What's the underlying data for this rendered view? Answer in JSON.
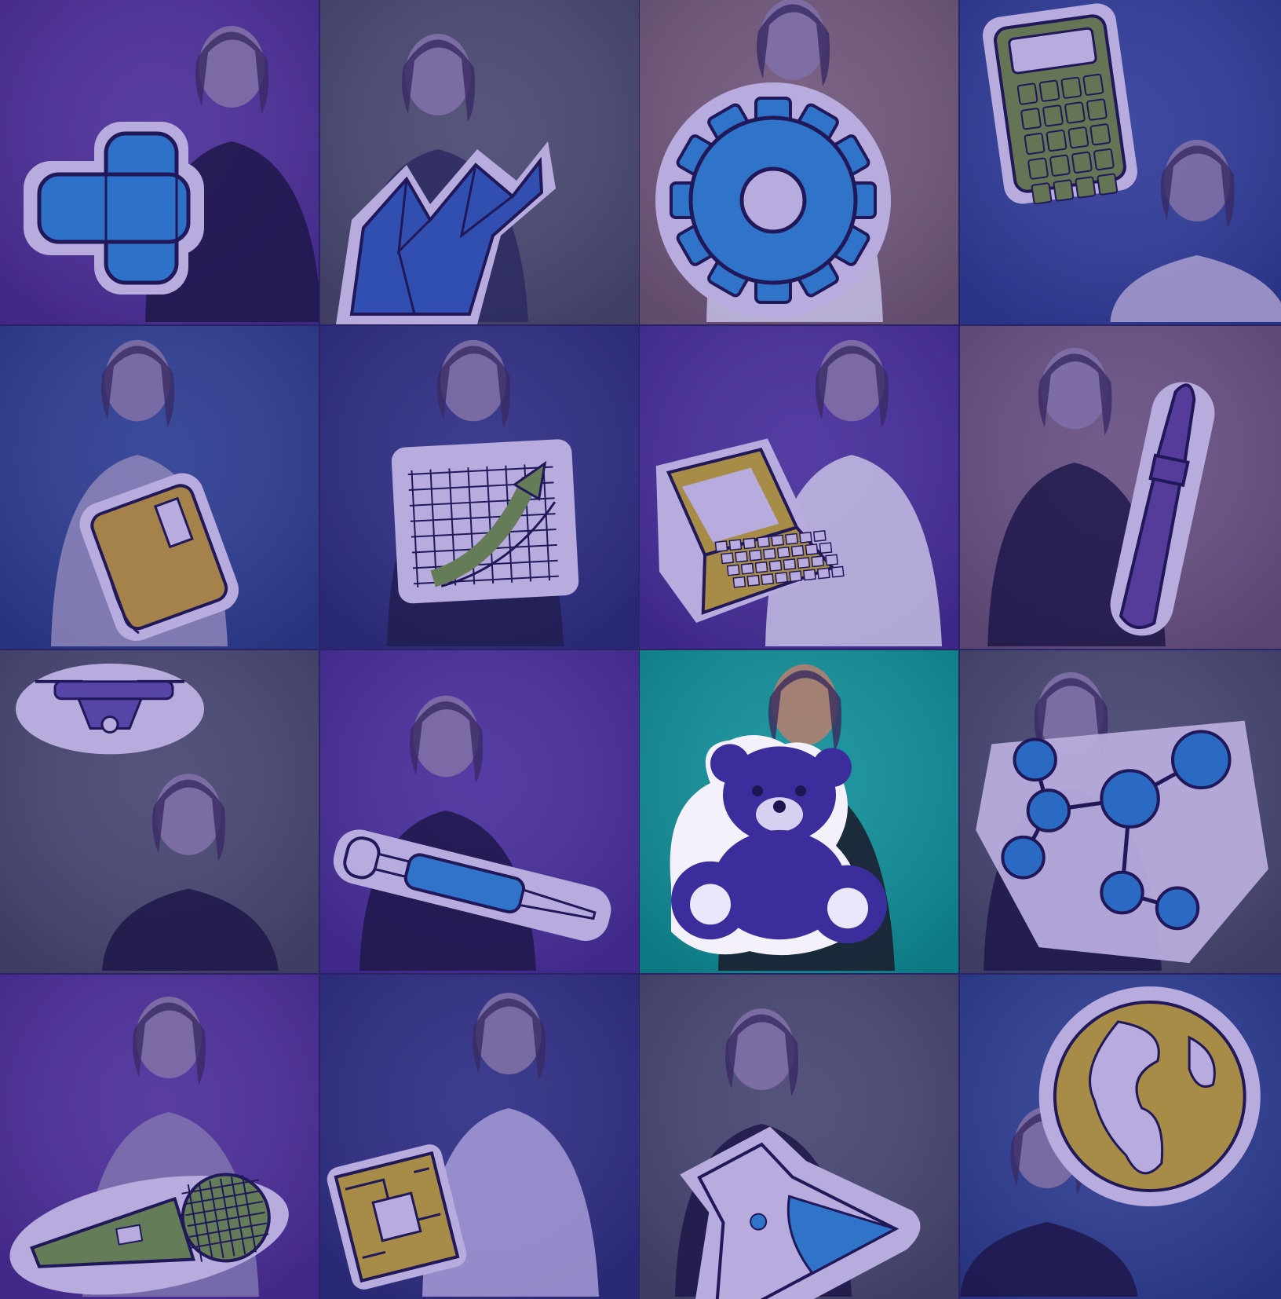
{
  "mosaic": {
    "tiles": [
      {
        "id": "bandage",
        "prop_icon": "bandage-icon",
        "bg": "#4f2f9a",
        "prop_color": "#2d7bd0",
        "active": false
      },
      {
        "id": "crystals",
        "prop_icon": "crystals-icon",
        "bg": "#4c4d6c",
        "prop_color": "#2f55b4",
        "active": false
      },
      {
        "id": "gear",
        "prop_icon": "gear-icon",
        "bg": "#7a5f78",
        "prop_color": "#2f7fd0",
        "active": false
      },
      {
        "id": "calculator",
        "prop_icon": "calculator-icon",
        "bg": "#2f3f9a",
        "prop_color": "#6c7f4c",
        "active": false
      },
      {
        "id": "book",
        "prop_icon": "book-icon",
        "bg": "#2c4092",
        "prop_color": "#b38f3e",
        "active": false
      },
      {
        "id": "chart",
        "prop_icon": "growth-chart-icon",
        "bg": "#2d2f82",
        "prop_color": "#6c8850",
        "active": false
      },
      {
        "id": "laptop",
        "prop_icon": "laptop-icon",
        "bg": "#4a2f9c",
        "prop_color": "#b59a3c",
        "active": false
      },
      {
        "id": "paintbrush",
        "prop_icon": "paintbrush-icon",
        "bg": "#6f5680",
        "prop_color": "#5a3f9a",
        "active": false
      },
      {
        "id": "drone",
        "prop_icon": "drone-icon",
        "bg": "#4a4b6c",
        "prop_color": "#5a48a8",
        "active": false
      },
      {
        "id": "syringe",
        "prop_icon": "syringe-icon",
        "bg": "#4b2f9c",
        "prop_color": "#2f7fd0",
        "active": false
      },
      {
        "id": "teddy-bear",
        "prop_icon": "teddy-bear-icon",
        "bg": "#0f8f9a",
        "prop_color": "#3b2e9c",
        "active": true
      },
      {
        "id": "molecule",
        "prop_icon": "molecule-icon",
        "bg": "#4a4b6c",
        "prop_color": "#2a74c8",
        "active": false
      },
      {
        "id": "microphone",
        "prop_icon": "microphone-icon",
        "bg": "#4f2f9a",
        "prop_color": "#6c8850",
        "active": false
      },
      {
        "id": "microchip",
        "prop_icon": "microchip-icon",
        "bg": "#2d2f82",
        "prop_color": "#b59a3c",
        "active": false
      },
      {
        "id": "flask",
        "prop_icon": "flask-icon",
        "bg": "#4a4b6c",
        "prop_color": "#2f7fd0",
        "active": false
      },
      {
        "id": "globe",
        "prop_icon": "globe-icon",
        "bg": "#2c4092",
        "prop_color": "#b59a3c",
        "active": false
      }
    ]
  }
}
